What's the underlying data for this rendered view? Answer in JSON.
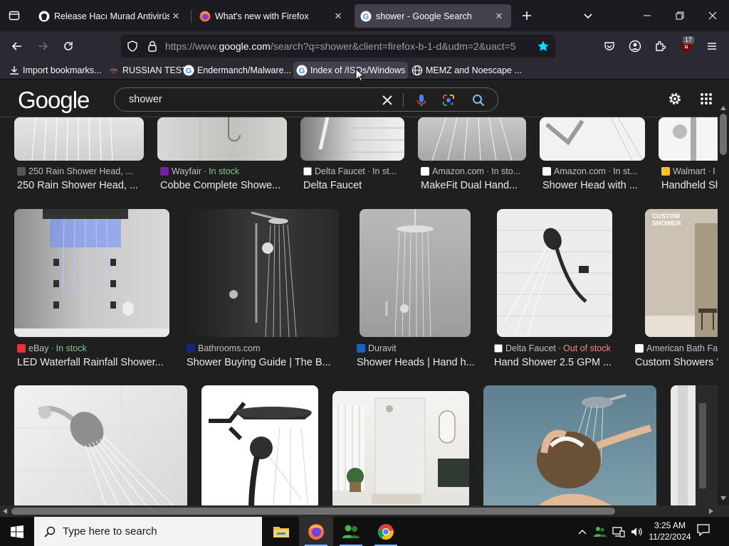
{
  "tabs": [
    {
      "label": "Release Hacı Murad Antivirüs B...",
      "active": false
    },
    {
      "label": "What's new with Firefox",
      "active": false
    },
    {
      "label": "shower - Google Search",
      "active": true
    }
  ],
  "urlbar": {
    "prefix": "https://www.",
    "domain": "google.com",
    "path": "/search?q=shower&client=firefox-b-1-d&udm=2&uact=5"
  },
  "extensions_badge": "17",
  "bookmarks": [
    "Import bookmarks...",
    "RUSSIAN TEST",
    "Endermanch/Malware...",
    "Index of /ISOs/Windows",
    "MEMZ and Noescape ..."
  ],
  "google": {
    "logo": "Google",
    "query": "shower"
  },
  "results": {
    "row1": [
      {
        "source": "250 Rain Shower Head, ...",
        "stock": "",
        "title": "250 Rain Shower Head, ..."
      },
      {
        "source": "Wayfair",
        "stock": "In stock",
        "title": "Cobbe Complete Showe..."
      },
      {
        "source": "Delta Faucet",
        "stock": "In st...",
        "title": "Delta Faucet"
      },
      {
        "source": "Amazon.com",
        "stock": "In sto...",
        "title": "MakeFit Dual Hand..."
      },
      {
        "source": "Amazon.com",
        "stock": "In st...",
        "title": "Shower Head with ..."
      },
      {
        "source": "Walmart",
        "stock": "I",
        "title": "Handheld Sh"
      }
    ],
    "row2": [
      {
        "source": "eBay",
        "stock": "In stock",
        "title": "LED Waterfall Rainfall Shower..."
      },
      {
        "source": "Bathrooms.com",
        "stock": "",
        "title": "Shower Buying Guide | The B..."
      },
      {
        "source": "Duravit",
        "stock": "",
        "title": "Shower Heads | Hand h..."
      },
      {
        "source": "Delta Faucet",
        "stock": "Out of stock",
        "title": "Hand Shower 2.5 GPM ..."
      },
      {
        "source": "American Bath Fa",
        "stock": "",
        "title": "Custom Showers '"
      }
    ],
    "custom_label_line1": "CUSTOM",
    "custom_label_line2": "SHOWER"
  },
  "taskbar": {
    "search_placeholder": "Type here to search",
    "time": "3:25 AM",
    "date": "11/22/2024"
  }
}
